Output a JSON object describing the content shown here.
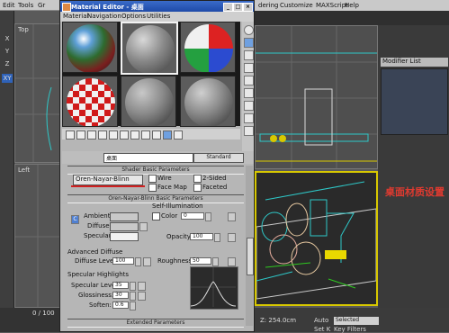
{
  "main_window": {
    "menus": [
      "Edit",
      "Tools",
      "Gr"
    ],
    "axis_buttons": [
      "X",
      "Y",
      "Z",
      "XY"
    ],
    "viewports": {
      "top": "Top",
      "left": "Left"
    },
    "timeline_value": "0 / 100",
    "bottom_text": "0 / 100"
  },
  "right_window": {
    "menus": [
      "dering",
      "Customize",
      "MAXScript",
      "Help"
    ],
    "modifier_list": "Modifier List",
    "caption": "桌面材质设置",
    "status_coord": "Z: 254.0cm",
    "auto_label": "Auto",
    "selected_value": "Selected",
    "set_key": "Set K",
    "key_filters": "Key Filters"
  },
  "material_editor": {
    "title": "Material Editor - 桌面",
    "title_buttons": [
      "_",
      "□",
      "×"
    ],
    "menus": [
      "Material",
      "Navigation",
      "Options",
      "Utilities"
    ],
    "slot_colors": [
      "#3a6fb0",
      "#8c8c8c",
      "#c8c8c8",
      "#c8c8c8",
      "#c8c8c8",
      "#c8c8c8"
    ],
    "material_name": "桌面",
    "material_type": "Standard",
    "shader_basic_header": "Shader Basic Parameters",
    "shader_type": "Oren-Nayar-Blinn",
    "wire_label": "Wire",
    "two_sided_label": "2-Sided",
    "face_map_label": "Face Map",
    "faceted_label": "Faceted",
    "onb_header": "Oren-Nayar-Blinn Basic Parameters",
    "self_illum_header": "Self-Illumination",
    "color_label": "Color",
    "color_value": "0",
    "ambient_label": "Ambient:",
    "diffuse_label": "Diffuse:",
    "specular_label": "Specular:",
    "opacity_label": "Opacity:",
    "opacity_value": "100",
    "lock_label": "C",
    "map_m_label": "M",
    "advanced_diffuse_header": "Advanced Diffuse",
    "diffuse_level_label": "Diffuse Level:",
    "diffuse_level_value": "100",
    "roughness_label": "Roughness:",
    "roughness_value": "50",
    "specular_highlights_header": "Specular Highlights",
    "specular_level_label": "Specular Level:",
    "specular_level_value": "35",
    "glossiness_label": "Glossiness:",
    "glossiness_value": "30",
    "soften_label": "Soften:",
    "soften_value": "0.6",
    "extended_params_header": "Extended Parameters"
  }
}
